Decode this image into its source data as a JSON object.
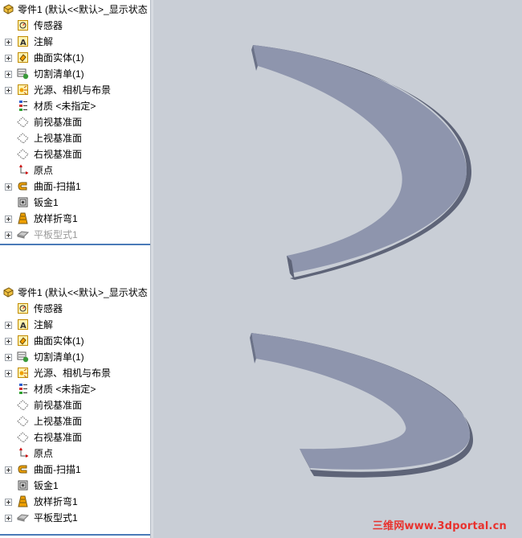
{
  "trees": [
    {
      "root_label": "零件1  (默认<<默认>_显示状态",
      "items": [
        {
          "label": "传感器",
          "icon": "sensor-icon",
          "expander": false,
          "disabled": false
        },
        {
          "label": "注解",
          "icon": "annotation-icon",
          "expander": true,
          "disabled": false
        },
        {
          "label": "曲面实体(1)",
          "icon": "surface-body-icon",
          "expander": true,
          "disabled": false
        },
        {
          "label": "切割清单(1)",
          "icon": "cut-list-icon",
          "expander": true,
          "disabled": false
        },
        {
          "label": "光源、相机与布景",
          "icon": "lights-cameras-icon",
          "expander": true,
          "disabled": false
        },
        {
          "label": "材质 <未指定>",
          "icon": "material-icon",
          "expander": false,
          "disabled": false
        },
        {
          "label": "前视基准面",
          "icon": "plane-icon",
          "expander": false,
          "disabled": false
        },
        {
          "label": "上视基准面",
          "icon": "plane-icon",
          "expander": false,
          "disabled": false
        },
        {
          "label": "右视基准面",
          "icon": "plane-icon",
          "expander": false,
          "disabled": false
        },
        {
          "label": "原点",
          "icon": "origin-icon",
          "expander": false,
          "disabled": false
        },
        {
          "label": "曲面-扫描1",
          "icon": "sweep-surface-icon",
          "expander": true,
          "disabled": false
        },
        {
          "label": "钣金1",
          "icon": "sheet-metal-icon",
          "expander": false,
          "disabled": false
        },
        {
          "label": "放样折弯1",
          "icon": "lofted-bend-icon",
          "expander": true,
          "disabled": false
        },
        {
          "label": "平板型式1",
          "icon": "flat-pattern-icon",
          "expander": true,
          "disabled": true
        }
      ]
    },
    {
      "root_label": "零件1  (默认<<默认>_显示状态",
      "items": [
        {
          "label": "传感器",
          "icon": "sensor-icon",
          "expander": false,
          "disabled": false
        },
        {
          "label": "注解",
          "icon": "annotation-icon",
          "expander": true,
          "disabled": false
        },
        {
          "label": "曲面实体(1)",
          "icon": "surface-body-icon",
          "expander": true,
          "disabled": false
        },
        {
          "label": "切割清单(1)",
          "icon": "cut-list-icon",
          "expander": true,
          "disabled": false
        },
        {
          "label": "光源、相机与布景",
          "icon": "lights-cameras-icon",
          "expander": true,
          "disabled": false
        },
        {
          "label": "材质 <未指定>",
          "icon": "material-icon",
          "expander": false,
          "disabled": false
        },
        {
          "label": "前视基准面",
          "icon": "plane-icon",
          "expander": false,
          "disabled": false
        },
        {
          "label": "上视基准面",
          "icon": "plane-icon",
          "expander": false,
          "disabled": false
        },
        {
          "label": "右视基准面",
          "icon": "plane-icon",
          "expander": false,
          "disabled": false
        },
        {
          "label": "原点",
          "icon": "origin-icon",
          "expander": false,
          "disabled": false
        },
        {
          "label": "曲面-扫描1",
          "icon": "sweep-surface-icon",
          "expander": true,
          "disabled": false
        },
        {
          "label": "钣金1",
          "icon": "sheet-metal-icon",
          "expander": false,
          "disabled": false
        },
        {
          "label": "放样折弯1",
          "icon": "lofted-bend-icon",
          "expander": true,
          "disabled": false
        },
        {
          "label": "平板型式1",
          "icon": "flat-pattern-icon",
          "expander": true,
          "disabled": false
        }
      ]
    }
  ],
  "viewport": {
    "background": "#c9ced6",
    "part_top_color": "#8e95ad",
    "part_edge_color": "#5e6478"
  },
  "watermark": "三维网www.3dportal.cn"
}
